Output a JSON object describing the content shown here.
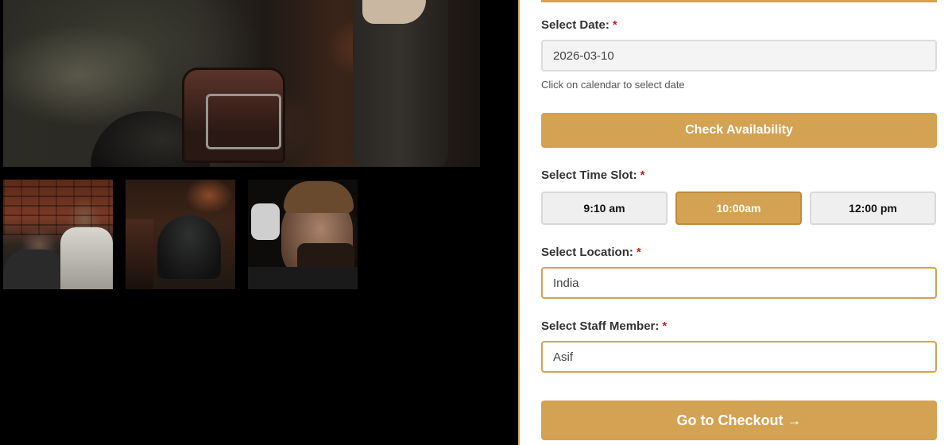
{
  "gallery": {
    "main_image": "barber-chair-photo",
    "thumbnails": [
      "barber-cutting-hair-photo",
      "client-in-cape-photo",
      "bearded-client-profile-photo"
    ]
  },
  "form": {
    "date": {
      "label": "Select Date:",
      "required_mark": "*",
      "value": "2026-03-10",
      "hint": "Click on calendar to select date"
    },
    "check_button": "Check Availability",
    "time_slot": {
      "label": "Select Time Slot:",
      "required_mark": "*",
      "slots": [
        "9:10 am",
        "10:00am",
        "12:00 pm"
      ],
      "selected": "10:00am"
    },
    "location": {
      "label": "Select Location:",
      "required_mark": "*",
      "value": "India"
    },
    "staff": {
      "label": "Select Staff Member:",
      "required_mark": "*",
      "value": "Asif"
    },
    "checkout_button": "Go to Checkout →"
  },
  "colors": {
    "accent": "#d4a253",
    "required": "#d11a1a"
  }
}
